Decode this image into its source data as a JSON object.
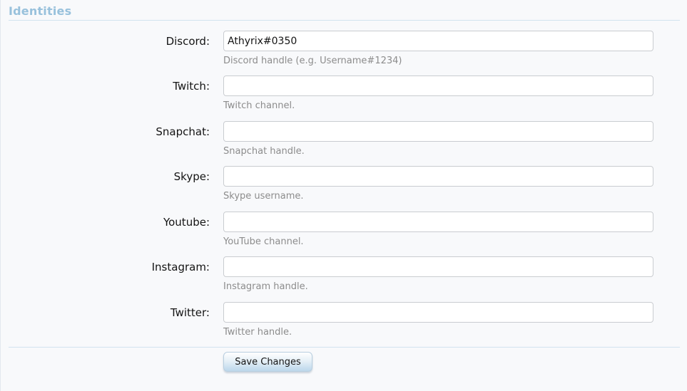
{
  "section": {
    "title": "Identities"
  },
  "fields": [
    {
      "label": "Discord:",
      "value": "Athyrix#0350",
      "hint": "Discord handle (e.g. Username#1234)"
    },
    {
      "label": "Twitch:",
      "value": "",
      "hint": "Twitch channel."
    },
    {
      "label": "Snapchat:",
      "value": "",
      "hint": "Snapchat handle."
    },
    {
      "label": "Skype:",
      "value": "",
      "hint": "Skype username."
    },
    {
      "label": "Youtube:",
      "value": "",
      "hint": "YouTube channel."
    },
    {
      "label": "Instagram:",
      "value": "",
      "hint": "Instagram handle."
    },
    {
      "label": "Twitter:",
      "value": "",
      "hint": "Twitter handle."
    }
  ],
  "actions": {
    "save_label": "Save Changes"
  },
  "colors": {
    "section_title": "#98c1dc",
    "divider": "#d2e3ef",
    "hint_text": "#8c8c8c"
  }
}
